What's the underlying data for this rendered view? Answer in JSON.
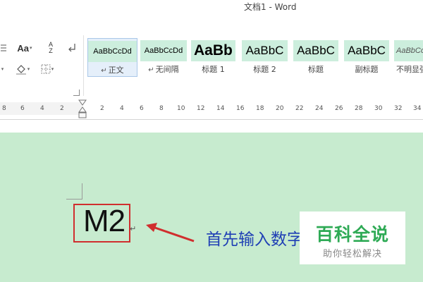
{
  "window": {
    "title": "文档1 - Word"
  },
  "toolbar": {
    "icons": [
      "bullets-icon",
      "change-case-icon",
      "sort-icon",
      "paragraph-mark-icon",
      "shading-icon",
      "borders-icon",
      "paragraph-launcher-icon"
    ],
    "change_case_label": "Aa",
    "sort_top": "A",
    "sort_bottom": "Z"
  },
  "styles": {
    "para_mark": "↵",
    "items": [
      {
        "sample": "AaBbCcDd",
        "label": "正文",
        "selected": true
      },
      {
        "sample": "AaBbCcDd",
        "label": "无间隔",
        "selected": false
      },
      {
        "sample": "AaBb",
        "label": "标题 1",
        "selected": false
      },
      {
        "sample": "AaBbC",
        "label": "标题 2",
        "selected": false
      },
      {
        "sample": "AaBbC",
        "label": "标题",
        "selected": false
      },
      {
        "sample": "AaBbC",
        "label": "副标题",
        "selected": false
      },
      {
        "sample": "AaBbCcDd",
        "label": "不明显强",
        "selected": false
      }
    ]
  },
  "ruler": {
    "left_ticks": [
      "8",
      "6",
      "4",
      "2"
    ],
    "right_ticks": [
      "2",
      "4",
      "6",
      "8",
      "10",
      "12",
      "14",
      "16",
      "18",
      "20",
      "22",
      "24",
      "26",
      "28",
      "30",
      "32",
      "34"
    ]
  },
  "document": {
    "text": "M2",
    "cursor_mark": "↵",
    "annotation": "首先输入数字"
  },
  "watermark": {
    "title": "百科全说",
    "subtitle": "助你轻松解决"
  },
  "colors": {
    "doc_background": "#c7ebcf",
    "style_sample_background": "#cceedd",
    "highlight_border": "#d02e2e",
    "annotation_text": "#1f3fb5",
    "watermark_green": "#2eaa55"
  }
}
